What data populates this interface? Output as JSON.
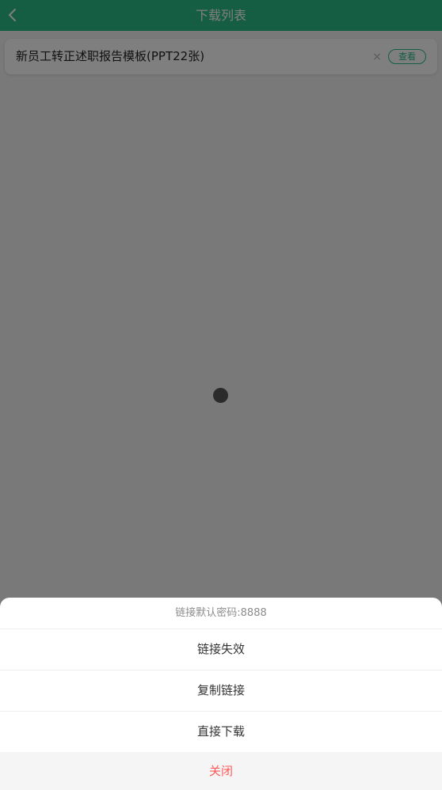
{
  "header": {
    "title": "下载列表",
    "back_icon": "chevron-left-icon"
  },
  "download_item": {
    "title": "新员工转正述职报告模板(PPT22张)",
    "close_glyph": "×",
    "view_label": "查看"
  },
  "action_sheet": {
    "hint": "链接默认密码:8888",
    "options": [
      {
        "label": "链接失效"
      },
      {
        "label": "复制链接"
      },
      {
        "label": "直接下载"
      }
    ],
    "cancel_label": "关闭"
  },
  "colors": {
    "brand": "#2bba86",
    "cancel": "#ff5a5a"
  }
}
